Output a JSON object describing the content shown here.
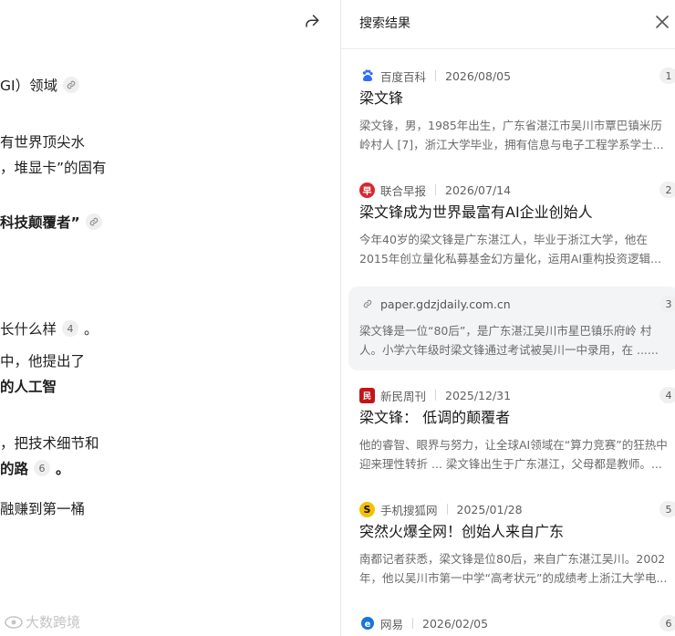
{
  "article": {
    "lines": [
      {
        "text": "GI）领域",
        "link": true
      },
      {
        "text": "有世界顶尖水"
      },
      {
        "text": "，堆显卡”的固有"
      },
      {
        "text": "科技颠覆者”",
        "bold": true,
        "link": true
      },
      {
        "text": "长什么样",
        "cite": "4",
        "trail": "。"
      },
      {
        "text": "中，他提出了"
      },
      {
        "text": "的人工智",
        "bold": true
      },
      {
        "text": "，把技术细节和"
      },
      {
        "text": "的路",
        "bold": true,
        "cite": "6",
        "trail": "。"
      },
      {
        "text": "融赚到第一桶"
      }
    ],
    "watermark": "大数跨境"
  },
  "panel": {
    "title": "搜索结果",
    "results": [
      {
        "index": "1",
        "source": "百度百科",
        "date": "2026/08/05",
        "logo": "baidu-paw",
        "title": "梁文锋",
        "snippet": [
          "梁文锋，男，1985年出生，广东省湛江市吴川市覃巴镇米历",
          "岭村人 [7]，浙江大学毕业，拥有信息与电子工程学系学士..."
        ]
      },
      {
        "index": "2",
        "source": "联合早报",
        "date": "2026/07/14",
        "logo": "zaobao",
        "title": "梁文锋成为世界最富有AI企业创始人",
        "snippet": [
          "今年40岁的梁文锋是广东湛江人，毕业于浙江大学，他在",
          "2015年创立量化私募基金幻方量化，运用AI重构投资逻辑..."
        ]
      },
      {
        "index": "3",
        "source": "paper.gdzjdaily.com.cn",
        "date": "",
        "logo": "link",
        "title": "",
        "snippet": [
          "梁文锋是一位“80后”，是广东湛江吴川市星巴镇乐府岭 村",
          "人。小学六年级时梁文锋通过考试被吴川一中录用，在 ......"
        ]
      },
      {
        "index": "4",
        "source": "新民周刊",
        "date": "2025/12/31",
        "logo": "xinmin",
        "title": "梁文锋： 低调的颠覆者",
        "snippet": [
          "他的睿智、眼界与努力，让全球AI领域在“算力竞赛”的狂热中",
          "迎来理性转折 ... 梁文锋出生于广东湛江，父母都是教师。..."
        ]
      },
      {
        "index": "5",
        "source": "手机搜狐网",
        "date": "2025/01/28",
        "logo": "sohu",
        "title": "突然火爆全网！创始人来自广东",
        "snippet": [
          "南都记者获悉，梁文锋是位80后，来自广东湛江吴川。2002",
          "年，他以吴川市第一中学“高考状元”的成绩考上浙江大学电..."
        ]
      },
      {
        "index": "6",
        "source": "网易",
        "date": "2026/02/05",
        "logo": "netease",
        "title": "",
        "snippet": []
      }
    ]
  }
}
